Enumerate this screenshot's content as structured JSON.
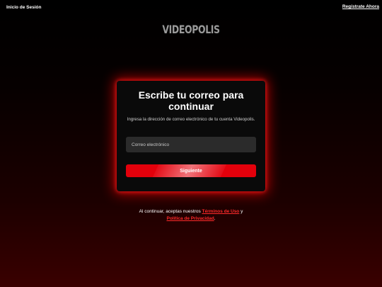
{
  "header": {
    "login_label": "Inicio de Sesión",
    "register_label": "Regístrate Ahora",
    "logo_text": "VIDEOPOLIS"
  },
  "card": {
    "title": "Escribe tu correo para continuar",
    "subtitle": "Ingresa la dirección de correo electrónico de tu cuenta Videopolis.",
    "email_placeholder": "Correo electrónico",
    "next_label": "Siguiente"
  },
  "legal": {
    "prefix": "Al continuar, aceptas nuestros ",
    "terms_label": "Términos de Uso",
    "conjunction": " y ",
    "privacy_label": "Política de Privacidad",
    "suffix": "."
  },
  "colors": {
    "accent": "#e3000b",
    "link": "#ff2a2a",
    "card_bg": "#0a0a0a",
    "input_bg": "#2b2b2b"
  }
}
